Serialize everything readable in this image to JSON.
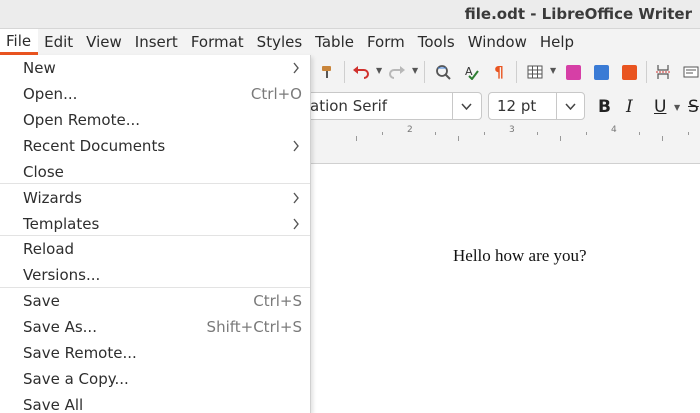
{
  "window": {
    "title": "file.odt - LibreOffice Writer"
  },
  "menubar": [
    "File",
    "Edit",
    "View",
    "Insert",
    "Format",
    "Styles",
    "Table",
    "Form",
    "Tools",
    "Window",
    "Help"
  ],
  "file_menu": {
    "items": [
      {
        "label": "New",
        "shortcut": "",
        "submenu": true
      },
      {
        "label": "Open...",
        "shortcut": "Ctrl+O",
        "submenu": false
      },
      {
        "label": "Open Remote...",
        "shortcut": "",
        "submenu": false
      },
      {
        "label": "Recent Documents",
        "shortcut": "",
        "submenu": true
      },
      {
        "label": "Close",
        "shortcut": "",
        "submenu": false
      },
      {
        "label": "Wizards",
        "shortcut": "",
        "submenu": true
      },
      {
        "label": "Templates",
        "shortcut": "",
        "submenu": true
      },
      {
        "label": "Reload",
        "shortcut": "",
        "submenu": false
      },
      {
        "label": "Versions...",
        "shortcut": "",
        "submenu": false
      },
      {
        "label": "Save",
        "shortcut": "Ctrl+S",
        "submenu": false
      },
      {
        "label": "Save As...",
        "shortcut": "Shift+Ctrl+S",
        "submenu": false
      },
      {
        "label": "Save Remote...",
        "shortcut": "",
        "submenu": false
      },
      {
        "label": "Save a Copy...",
        "shortcut": "",
        "submenu": false
      },
      {
        "label": "Save All",
        "shortcut": "",
        "submenu": false
      }
    ]
  },
  "formatting": {
    "font_name_visible": "ation Serif",
    "font_size": "12 pt",
    "bold": "B",
    "italic": "I",
    "underline": "U"
  },
  "ruler": {
    "labels": [
      "2",
      "3",
      "4"
    ]
  },
  "document": {
    "text": "Hello how are you?"
  },
  "colors": {
    "accent": "#e95420",
    "undo": "#d0312d",
    "spell_check": "#2e7d32",
    "formatting_marks": "#e95420"
  }
}
